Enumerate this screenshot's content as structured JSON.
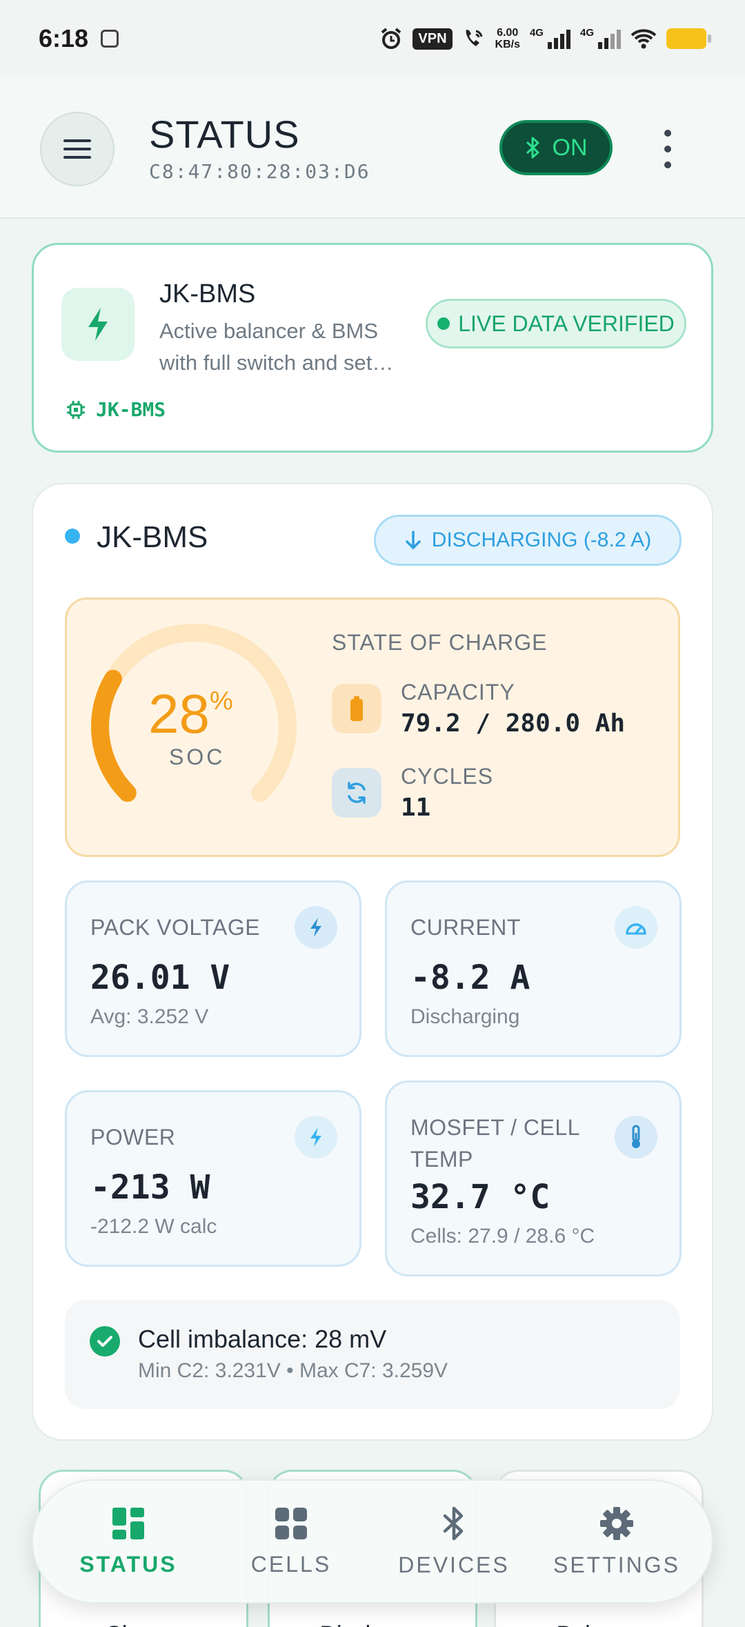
{
  "status_bar": {
    "time": "6:18",
    "vpn": "VPN",
    "net_speed_value": "6.00",
    "net_speed_unit": "KB/s",
    "network_type_1": "4G",
    "network_type_2": "4G"
  },
  "header": {
    "title": "STATUS",
    "mac_address": "C8:47:80:28:03:D6",
    "bluetooth_label": "ON"
  },
  "device_card": {
    "name": "JK-BMS",
    "description_line1": "Active balancer & BMS",
    "description_line2": "with full switch and set…",
    "live_badge": "LIVE DATA VERIFIED",
    "chip_label": "JK-BMS"
  },
  "battery_card": {
    "title": "JK-BMS",
    "state_badge": "DISCHARGING (-8.2 A)",
    "soc": {
      "percent": 28,
      "value": "28",
      "unit": "%",
      "label": "SOC",
      "heading": "STATE OF CHARGE",
      "capacity_label": "CAPACITY",
      "capacity_value": "79.2 / 280.0 Ah",
      "cycles_label": "CYCLES",
      "cycles_value": "11"
    },
    "stats": {
      "pack_voltage": {
        "label": "PACK VOLTAGE",
        "value": "26.01 V",
        "sub": "Avg: 3.252 V"
      },
      "current": {
        "label": "CURRENT",
        "value": "-8.2 A",
        "sub": "Discharging"
      },
      "power": {
        "label": "POWER",
        "value": "-213 W",
        "sub": "-212.2 W calc"
      },
      "temp": {
        "label_line1": "MOSFET / CELL",
        "label_line2": "TEMP",
        "value": "32.7 °C",
        "sub": "Cells: 27.9 / 28.6 °C"
      }
    },
    "imbalance": {
      "title": "Cell imbalance: 28 mV",
      "detail": "Min C2: 3.231V • Max C7: 3.259V"
    }
  },
  "behind_cards": {
    "charge": "Charge",
    "discharge": "Discharge",
    "balance": "Balance"
  },
  "tabs": [
    {
      "label": "STATUS",
      "icon": "grid-icon",
      "active": true
    },
    {
      "label": "CELLS",
      "icon": "cells-icon",
      "active": false
    },
    {
      "label": "DEVICES",
      "icon": "bluetooth-icon",
      "active": false
    },
    {
      "label": "SETTINGS",
      "icon": "gear-icon",
      "active": false
    }
  ],
  "colors": {
    "accent_green": "#18a86b",
    "soc_orange": "#f39c17",
    "discharge_blue": "#2d9fdf"
  }
}
